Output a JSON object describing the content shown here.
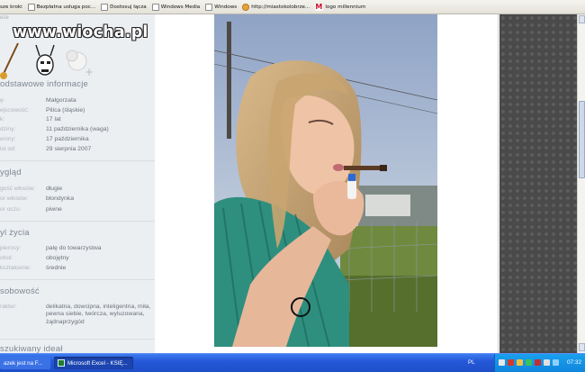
{
  "links_bar": {
    "items": [
      {
        "label": "sze kroki",
        "icon": "page-icon"
      },
      {
        "label": "Bezpłatna usługa poc...",
        "icon": "page-icon"
      },
      {
        "label": "Dostosuj łącza",
        "icon": "page-icon"
      },
      {
        "label": "Windows Media",
        "icon": "page-icon"
      },
      {
        "label": "Windows",
        "icon": "page-icon"
      },
      {
        "label": "http://miastokolobrze...",
        "icon": "globe-icon"
      },
      {
        "label": "logo millennium",
        "icon": "millennium-m-icon"
      }
    ]
  },
  "watermark": {
    "text": "www.wiocha.pl"
  },
  "sidebar": {
    "top_tab": "eze",
    "sections": {
      "basic": {
        "title": "odstawowe informacje",
        "rows": [
          {
            "label": "ę:",
            "value": "Małgorzata"
          },
          {
            "label": "ejscowość:",
            "value": "Pilica (śląskie)"
          },
          {
            "label": "k:",
            "value": "17 lat"
          },
          {
            "label": "dziny:",
            "value": "11 października (waga)"
          },
          {
            "label": "eniny:",
            "value": "17 października"
          },
          {
            "label": "ist od:",
            "value": "29 sierpnia 2007"
          }
        ]
      },
      "looks": {
        "title": "ygląd",
        "rows": [
          {
            "label": "gość włosów:",
            "value": "długie"
          },
          {
            "label": "or włosów:",
            "value": "blondynka"
          },
          {
            "label": "or oczu:",
            "value": "piwne"
          }
        ]
      },
      "lifestyle": {
        "title": "yl życia",
        "rows": [
          {
            "label": "pierosy:",
            "value": "palę do towarzystwa"
          },
          {
            "label": "ohol:",
            "value": "obojętny"
          },
          {
            "label": "kształcenie:",
            "value": "średnie"
          }
        ]
      },
      "personality": {
        "title": "sobowość",
        "rows": [
          {
            "label": "rakter:",
            "value": "delikatna, dowcipna, inteligentna, miła, pewna siebie, twórcza, wyluzowana, żądnaprzygód"
          }
        ]
      },
      "ideal": {
        "title": "szukiwany ideał"
      }
    }
  },
  "taskbar": {
    "tasks": [
      {
        "label": "azek jest na F..."
      },
      {
        "label": "Microsoft Excel - KSIĘ..."
      }
    ],
    "language": "PL",
    "clock": "07:32"
  }
}
